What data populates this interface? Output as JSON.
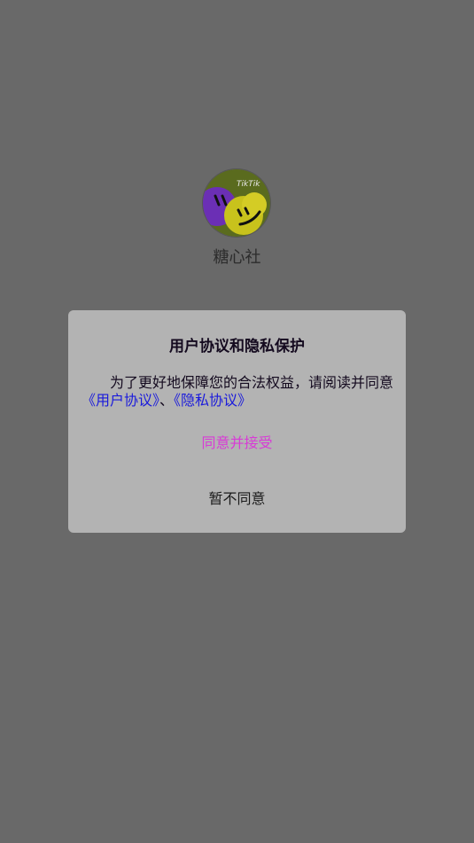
{
  "app": {
    "name": "糖心社",
    "logo_icon": "smiley-balls-logo",
    "logo_text": "TikTik"
  },
  "dialog": {
    "title": "用户协议和隐私保护",
    "body_intro": "为了更好地保障您的合法权益，请阅读并同意",
    "link_user_agreement": "《用户协议》",
    "separator": "、",
    "link_privacy_policy": "《隐私协议》",
    "agree_label": "同意并接受",
    "disagree_label": "暂不同意"
  },
  "colors": {
    "overlay": "#696969",
    "dialog_bg": "#b3b3b3",
    "link": "#1a1adc",
    "agree": "#d83bd6"
  }
}
